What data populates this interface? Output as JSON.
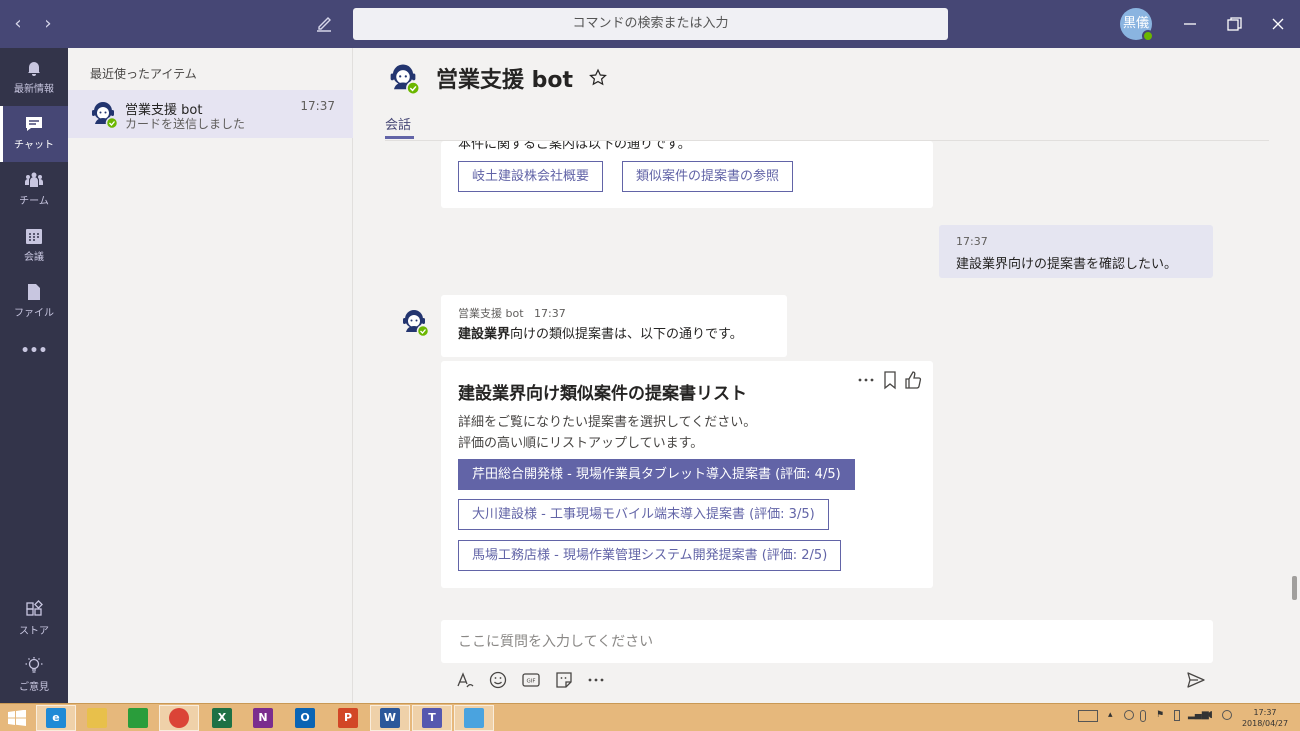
{
  "titlebar": {
    "search_placeholder": "コマンドの検索または入力",
    "user_initials": "黒儀"
  },
  "rail": {
    "items": [
      {
        "label": "最新情報",
        "icon": "bell-icon"
      },
      {
        "label": "チャット",
        "icon": "chat-icon"
      },
      {
        "label": "チーム",
        "icon": "teams-icon"
      },
      {
        "label": "会議",
        "icon": "calendar-icon"
      },
      {
        "label": "ファイル",
        "icon": "file-icon"
      }
    ],
    "more": "•••",
    "bottom": [
      {
        "label": "ストア",
        "icon": "store-icon"
      },
      {
        "label": "ご意見",
        "icon": "feedback-icon"
      }
    ]
  },
  "leftpane": {
    "header": "最近使ったアイテム",
    "recent": [
      {
        "name": "営業支援 bot",
        "time": "17:37",
        "preview": "カードを送信しました"
      }
    ]
  },
  "conversation": {
    "title": "営業支援 bot",
    "tab": "会話",
    "prev_card": {
      "cut_text": "本件に関するご案内は以下の通りです。",
      "buttons": [
        "岐土建設株会社概要",
        "類似案件の提案書の参照"
      ]
    },
    "my_message": {
      "time": "17:37",
      "text": "建設業界向けの提案書を確認したい。"
    },
    "bot_message": {
      "sender": "営業支援 bot",
      "time": "17:37",
      "text_bold": "建設業界",
      "text_rest": "向けの類似提案書は、以下の通りです。"
    },
    "list_card": {
      "title": "建設業界向け類似案件の提案書リスト",
      "desc1": "詳細をご覧になりたい提案書を選択してください。",
      "desc2": "評価の高い順にリストアップしています。",
      "options": [
        "芹田総合開発様 - 現場作業員タブレット導入提案書 (評価: 4/5)",
        "大川建設様 - 工事現場モバイル端末導入提案書 (評価: 3/5)",
        "馬場工務店様 - 現場作業管理システム開発提案書 (評価: 2/5)"
      ]
    },
    "composer_placeholder": "ここに質問を入力してください"
  },
  "taskbar": {
    "clock_time": "17:37",
    "clock_date": "2018/04/27"
  },
  "colors": {
    "brand": "#464775",
    "accent": "#6264a7",
    "presence": "#6bb700"
  }
}
